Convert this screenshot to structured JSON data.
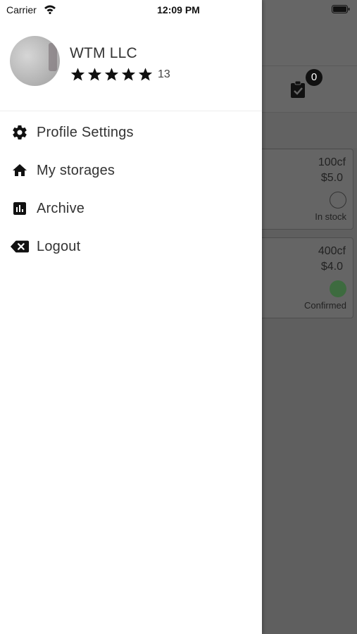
{
  "status_bar": {
    "carrier": "Carrier",
    "time": "12:09 PM"
  },
  "profile": {
    "name": "WTM LLC",
    "rating": 5,
    "rating_count": "13"
  },
  "menu": {
    "items": [
      {
        "label": "Profile Settings",
        "icon": "gear-icon"
      },
      {
        "label": "My storages",
        "icon": "home-icon"
      },
      {
        "label": "Archive",
        "icon": "bar-chart-icon"
      },
      {
        "label": "Logout",
        "icon": "backspace-icon"
      }
    ]
  },
  "background": {
    "badge_count": "0",
    "cards": [
      {
        "size": "100cf",
        "price": "$5.0",
        "status": "In stock",
        "status_filled": false
      },
      {
        "size": "400cf",
        "price": "$4.0",
        "status": "Confirmed",
        "status_filled": true
      }
    ]
  },
  "colors": {
    "confirmed_dot": "#3d6b3f",
    "overlay": "#5f5f5f"
  }
}
